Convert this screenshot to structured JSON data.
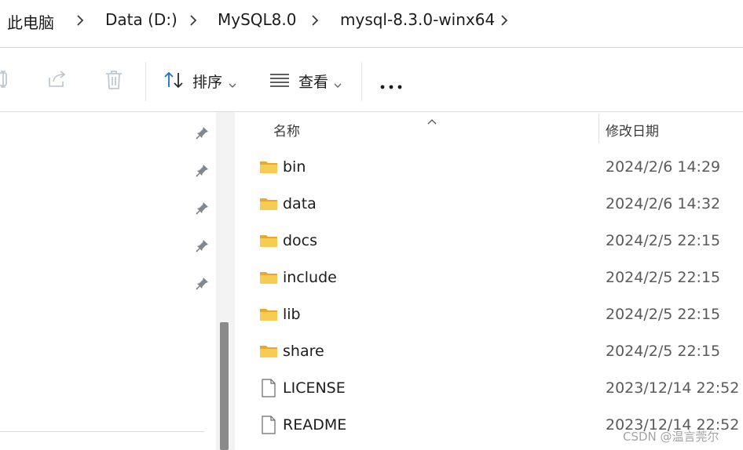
{
  "breadcrumb": {
    "items": [
      "此电脑",
      "Data (D:)",
      "MySQL8.0",
      "mysql-8.3.0-winx64"
    ]
  },
  "toolbar": {
    "sort_label": "排序",
    "view_label": "查看"
  },
  "columns": {
    "name": "名称",
    "modified": "修改日期"
  },
  "files": [
    {
      "name": "bin",
      "date": "2024/2/6 14:29",
      "icon": "folder-icon"
    },
    {
      "name": "data",
      "date": "2024/2/6 14:32",
      "icon": "folder-icon"
    },
    {
      "name": "docs",
      "date": "2024/2/5 22:15",
      "icon": "folder-icon"
    },
    {
      "name": "include",
      "date": "2024/2/5 22:15",
      "icon": "folder-icon"
    },
    {
      "name": "lib",
      "date": "2024/2/5 22:15",
      "icon": "folder-icon"
    },
    {
      "name": "share",
      "date": "2024/2/5 22:15",
      "icon": "folder-icon"
    },
    {
      "name": "LICENSE",
      "date": "2023/12/14 22:52",
      "icon": "file-icon"
    },
    {
      "name": "README",
      "date": "2023/12/14 22:52",
      "icon": "file-icon"
    }
  ],
  "watermark": "CSDN @温言莞尔",
  "colors": {
    "folder": "#f4c144",
    "sort_icon_accent": "#1e6fd0"
  }
}
